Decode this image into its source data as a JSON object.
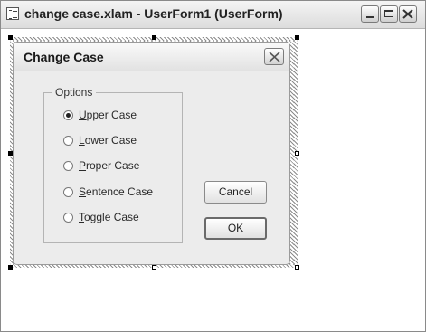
{
  "window": {
    "title": "change case.xlam - UserForm1 (UserForm)",
    "controls": {
      "minimize": "minimize-icon",
      "maximize": "maximize-icon",
      "close": "close-icon"
    }
  },
  "userform": {
    "title": "Change Case",
    "options_frame": {
      "caption": "Options",
      "options": [
        {
          "accel": "U",
          "rest": "pper Case",
          "checked": true
        },
        {
          "accel": "L",
          "rest": "ower Case",
          "checked": false
        },
        {
          "accel": "P",
          "rest": "roper Case",
          "checked": false
        },
        {
          "accel": "S",
          "rest": "entence Case",
          "checked": false
        },
        {
          "accel": "T",
          "rest": "oggle Case",
          "checked": false
        }
      ]
    },
    "buttons": {
      "cancel": "Cancel",
      "ok": "OK"
    }
  },
  "colors": {
    "form_background": "#ececec",
    "window_background": "#ffffff",
    "selection_hatch": "#8c8c8c"
  }
}
